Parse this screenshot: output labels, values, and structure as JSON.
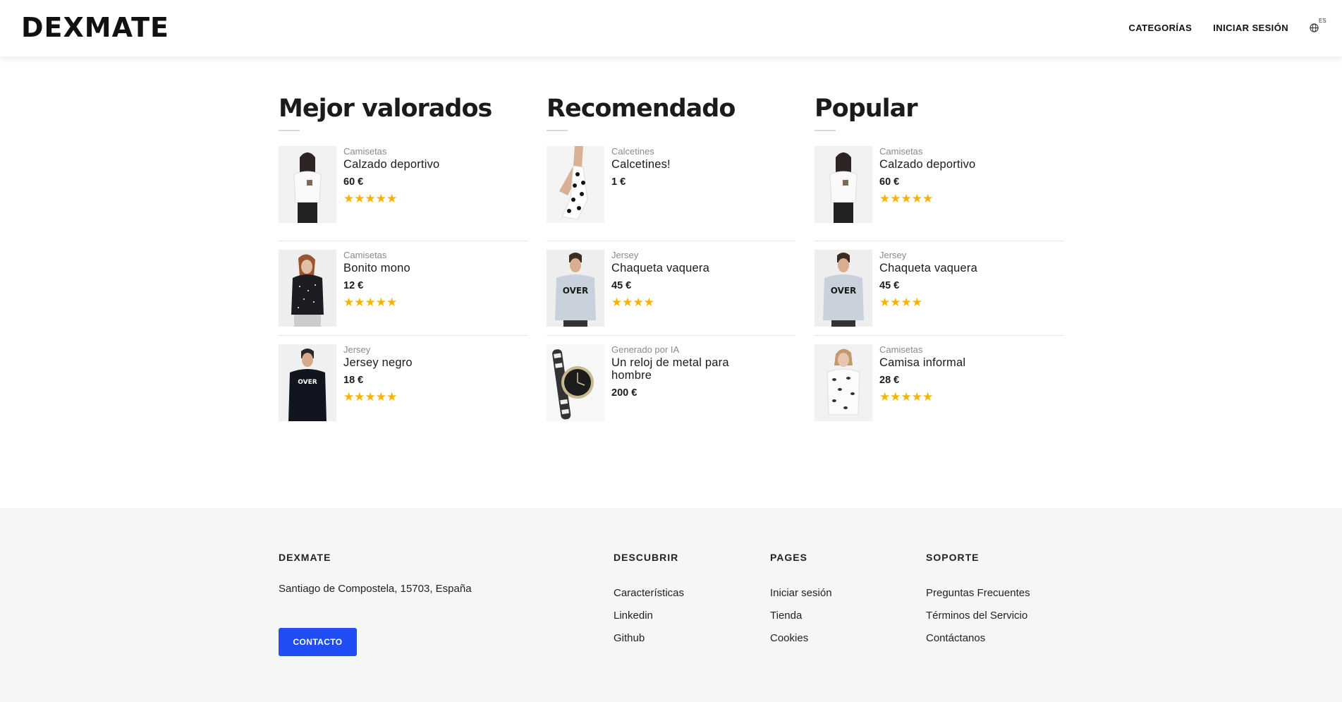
{
  "header": {
    "logo": "DEXMATE",
    "nav": {
      "categories": "CATEGORÍAS",
      "login": "INICIAR SESIÓN",
      "lang": "ES"
    }
  },
  "sections": [
    {
      "title": "Mejor valorados",
      "items": [
        {
          "category": "Camisetas",
          "name": "Calzado deportivo",
          "price": "60 €",
          "stars": "★★★★★",
          "rating": 5
        },
        {
          "category": "Camisetas",
          "name": "Bonito mono",
          "price": "12 €",
          "stars": "★★★★★",
          "rating": 5
        },
        {
          "category": "Jersey",
          "name": "Jersey negro",
          "price": "18 €",
          "stars": "★★★★★",
          "rating": 5
        }
      ]
    },
    {
      "title": "Recomendado",
      "items": [
        {
          "category": "Calcetines",
          "name": "Calcetines!",
          "price": "1 €",
          "stars": "",
          "rating": 0
        },
        {
          "category": "Jersey",
          "name": "Chaqueta vaquera",
          "price": "45 €",
          "stars": "★★★★",
          "rating": 4
        },
        {
          "category": "Generado por IA",
          "name": "Un reloj de metal para hombre",
          "price": "200 €",
          "stars": "",
          "rating": 0
        }
      ]
    },
    {
      "title": "Popular",
      "items": [
        {
          "category": "Camisetas",
          "name": "Calzado deportivo",
          "price": "60 €",
          "stars": "★★★★★",
          "rating": 5
        },
        {
          "category": "Jersey",
          "name": "Chaqueta vaquera",
          "price": "45 €",
          "stars": "★★★★",
          "rating": 4
        },
        {
          "category": "Camisetas",
          "name": "Camisa informal",
          "price": "28 €",
          "stars": "★★★★★",
          "rating": 5
        }
      ]
    }
  ],
  "footer": {
    "brand": "DEXMATE",
    "address": "Santiago de Compostela, 15703, España",
    "contact_button": "CONTACTO",
    "columns": [
      {
        "heading": "DESCUBRIR",
        "links": [
          "Características",
          "Linkedin",
          "Github"
        ]
      },
      {
        "heading": "PAGES",
        "links": [
          "Iniciar sesión",
          "Tienda",
          "Cookies"
        ]
      },
      {
        "heading": "SOPORTE",
        "links": [
          "Preguntas Frecuentes",
          "Términos del Servicio",
          "Contáctanos"
        ]
      }
    ]
  },
  "colors": {
    "accent": "#1f4ef5",
    "star": "#f6b400",
    "footer_bg": "#f6f6f6"
  }
}
